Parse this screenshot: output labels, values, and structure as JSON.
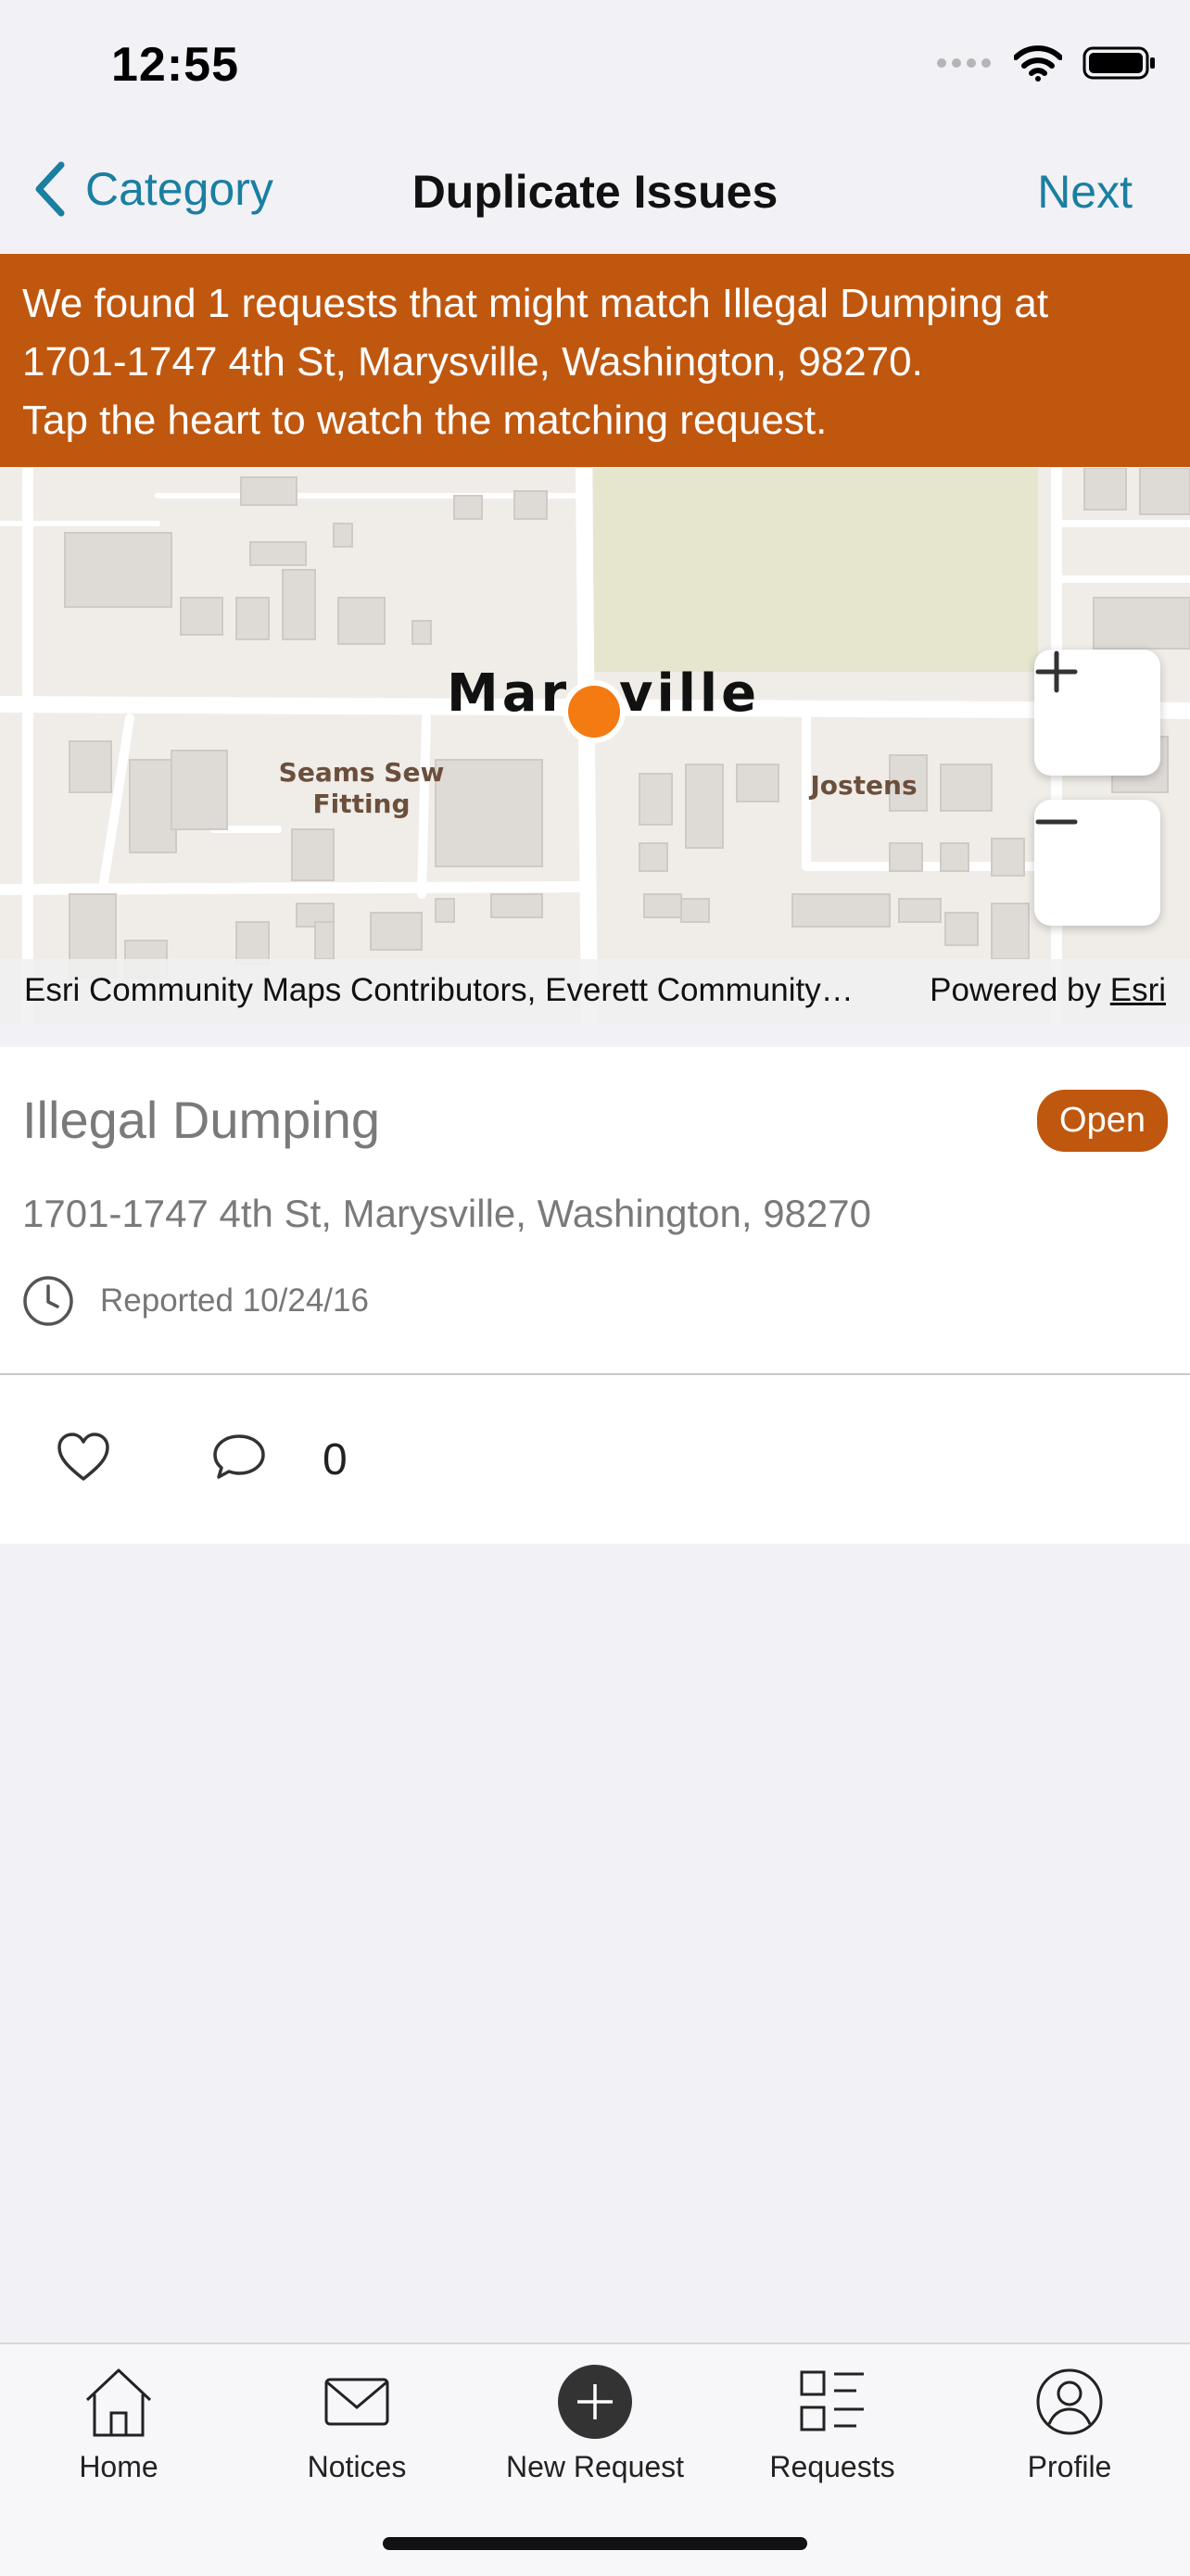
{
  "status_bar": {
    "time": "12:55"
  },
  "nav": {
    "back_label": "Category",
    "title": "Duplicate Issues",
    "next_label": "Next"
  },
  "banner": {
    "lines": [
      "We found 1 requests that might match Illegal Dumping at",
      "1701-1747 4th St, Marysville, Washington, 98270.",
      "Tap the heart to watch the matching request."
    ]
  },
  "map": {
    "place_label_left": "Mar",
    "place_label_right": "ville",
    "poi_labels": [
      "Seams Sew",
      "Fitting",
      "Jostens"
    ],
    "attribution": "Esri Community Maps Contributors, Everett Community…",
    "powered_by": "Powered by",
    "powered_link": "Esri",
    "marker_color": "#f47a12"
  },
  "request": {
    "title": "Illegal Dumping",
    "status": "Open",
    "address": "1701-1747 4th St, Marysville, Washington, 98270",
    "reported": "Reported 10/24/16",
    "comment_count": "0"
  },
  "tab_bar": {
    "tabs": [
      {
        "label": "Home",
        "icon": "home-icon"
      },
      {
        "label": "Notices",
        "icon": "mail-icon"
      },
      {
        "label": "New Request",
        "icon": "plus-circle-icon"
      },
      {
        "label": "Requests",
        "icon": "list-icon"
      },
      {
        "label": "Profile",
        "icon": "person-icon"
      }
    ]
  },
  "colors": {
    "accent": "#1a7fa0",
    "brand": "#c0570f",
    "marker": "#f47a12"
  }
}
